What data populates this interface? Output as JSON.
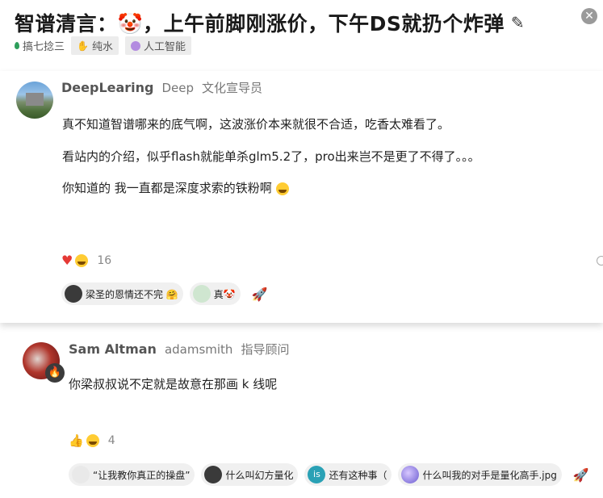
{
  "topic": {
    "title": "智谱清言：🤡，上午前脚刚涨价，下午DS就扔个炸弹",
    "category": "搞七捻三",
    "tags": [
      "纯水",
      "人工智能"
    ]
  },
  "posts": [
    {
      "username": "DeepLearing",
      "alt_name": "Deep",
      "user_title": "文化宣导员",
      "paragraphs": [
        "真不知道智谱哪来的底气啊，这波涨价本来就很不合适，吃香太难看了。",
        "看站内的介绍，似乎flash就能单杀glm5.2了，pro出来岂不是更了不得了。。。",
        "你知道的 我一直都是深度求索的铁粉啊"
      ],
      "reaction_count": "16",
      "linked_posts": [
        "梁圣的恩情还不完 🤗",
        "真🤡"
      ]
    },
    {
      "username": "Sam Altman",
      "alt_name": "adamsmith",
      "user_title": "指导顾问",
      "paragraphs": [
        "你梁叔叔说不定就是故意在那画 k 线呢"
      ],
      "reaction_count": "4",
      "linked_posts": [
        "“让我教你真正的操盘”",
        "什么叫幻方量化",
        "还有这种事（",
        "什么叫我的对手是量化高手.jpg"
      ],
      "chip_badge": "is"
    }
  ],
  "icons": {
    "edit": "pencil-icon",
    "close": "close-icon",
    "heart": "heart-icon",
    "laugh": "laugh-emoji-icon",
    "thumbs_up": "thumbs-up-icon",
    "rocket": "rocket-icon"
  },
  "colors": {
    "category_dot": "#2e9e5b",
    "heart": "#e53935"
  }
}
